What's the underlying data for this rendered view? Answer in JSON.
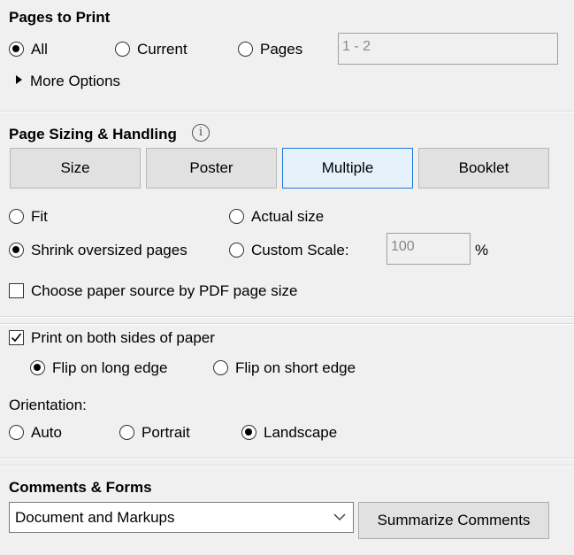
{
  "pages_to_print": {
    "title": "Pages to Print",
    "all_label": "All",
    "current_label": "Current",
    "pages_label": "Pages",
    "pages_range_value": "1 - 2",
    "more_options_label": "More Options",
    "selected": "All"
  },
  "page_sizing": {
    "title": "Page Sizing & Handling",
    "tabs": [
      "Size",
      "Poster",
      "Multiple",
      "Booklet"
    ],
    "selected_tab": "Multiple",
    "fit_label": "Fit",
    "actual_size_label": "Actual size",
    "shrink_label": "Shrink oversized pages",
    "custom_scale_label": "Custom Scale:",
    "custom_scale_value": "100",
    "percent_label": "%",
    "paper_source_label": "Choose paper source by PDF page size",
    "paper_source_checked": false,
    "selected_scaling": "Shrink oversized pages"
  },
  "duplex": {
    "both_sides_label": "Print on both sides of paper",
    "both_sides_checked": true,
    "long_edge_label": "Flip on long edge",
    "short_edge_label": "Flip on short edge",
    "selected_flip": "Flip on long edge"
  },
  "orientation": {
    "title": "Orientation:",
    "auto_label": "Auto",
    "portrait_label": "Portrait",
    "landscape_label": "Landscape",
    "selected": "Landscape"
  },
  "comments_forms": {
    "title": "Comments & Forms",
    "dropdown_value": "Document and Markups",
    "summarize_label": "Summarize Comments"
  }
}
